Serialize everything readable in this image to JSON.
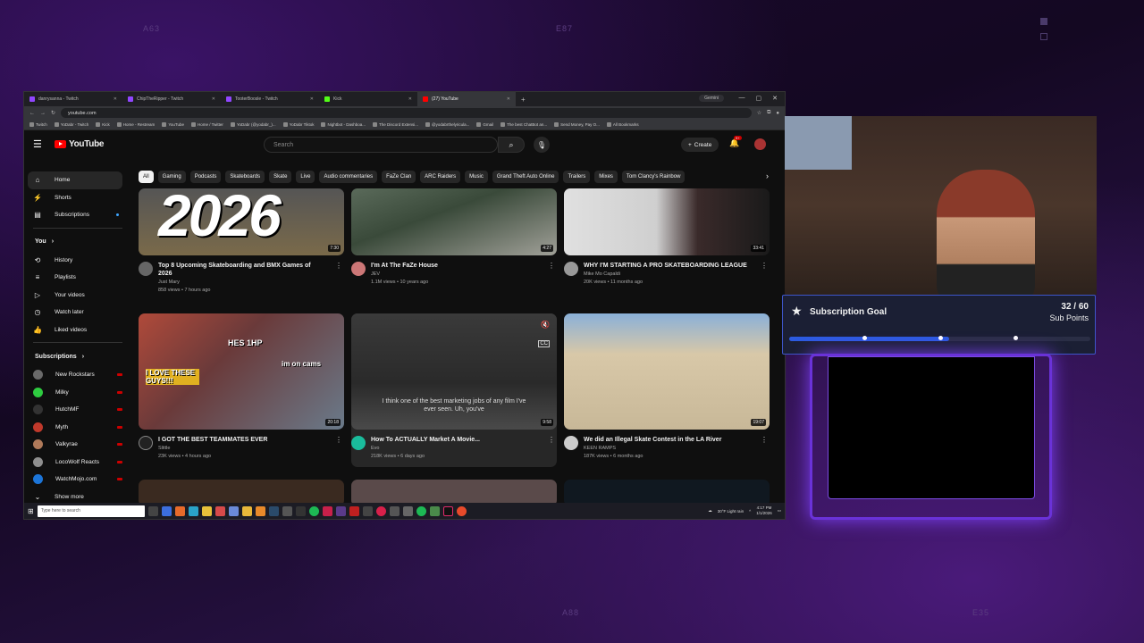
{
  "watermarks": {
    "top_left": "A63",
    "top_mid": "E87",
    "bottom_mid": "A88",
    "bottom_right": "E35"
  },
  "browser": {
    "tabs": [
      {
        "label": "danrysanna - Twitch"
      },
      {
        "label": "ChipTheRipper - Twitch"
      },
      {
        "label": "TooterBoosle - Twitch"
      },
      {
        "label": "Kick"
      },
      {
        "label": "(27) YouTube"
      }
    ],
    "gemini": "Gemini",
    "url": "youtube.com",
    "bookmarks": [
      "Twitch",
      "YoDabr - Twitch",
      "Kick",
      "Home - Restream",
      "YouTube",
      "Home / Twitter",
      "YoDabr (@yodabr_)...",
      "YoDabr Tiktok",
      "Nightbot - Dashboa...",
      "The Discord Extensi...",
      "@yodabrthelyricula...",
      "Gmail",
      "The best ChatBot an...",
      "Send Money, Pay O...",
      "All Bookmarks"
    ]
  },
  "youtube": {
    "logo": "YouTube",
    "search_placeholder": "Search",
    "create": "Create",
    "notif_count": "9+",
    "sidebar": [
      {
        "label": "Home",
        "icon": "home-icon"
      },
      {
        "label": "Shorts",
        "icon": "shorts-icon"
      },
      {
        "label": "Subscriptions",
        "icon": "subscriptions-icon"
      }
    ],
    "you": "You",
    "you_items": [
      {
        "label": "History"
      },
      {
        "label": "Playlists"
      },
      {
        "label": "Your videos"
      },
      {
        "label": "Watch later"
      },
      {
        "label": "Liked videos"
      }
    ],
    "subs_header": "Subscriptions",
    "subs": [
      {
        "label": "New Rockstars",
        "color": "#6a6a6a"
      },
      {
        "label": "Milky",
        "color": "#2ecc40"
      },
      {
        "label": "HutchMF",
        "color": "#333"
      },
      {
        "label": "Myth",
        "color": "#c0392b"
      },
      {
        "label": "Valkyrae",
        "color": "#b07a5a"
      },
      {
        "label": "LocoWolf Reacts",
        "color": "#8e8e8e"
      },
      {
        "label": "WatchMojo.com",
        "color": "#1c75d8"
      }
    ],
    "show_more": "Show more",
    "chips": [
      "All",
      "Gaming",
      "Podcasts",
      "Skateboards",
      "Skate",
      "Live",
      "Audio commentaries",
      "FaZe Clan",
      "ARC Raiders",
      "Music",
      "Grand Theft Auto Online",
      "Trailers",
      "Mixes",
      "Tom Clancy's Rainbow"
    ],
    "videos": [
      {
        "title": "Top 8 Upcoming Skateboarding and BMX Games of 2026",
        "channel": "Just Mary",
        "views": "858 views • 7 hours ago",
        "duration": "7:30",
        "thumb_text": "2026",
        "colors": [
          "#3b3b3b",
          "#7a6a4a"
        ],
        "avatar": "#666"
      },
      {
        "title": "I'm At The FaZe House",
        "channel": "JEV",
        "views": "1.1M views • 10 years ago",
        "duration": "4:27",
        "colors": [
          "#4a5a4a",
          "#8a8a80"
        ],
        "avatar": "#c77"
      },
      {
        "title": "WHY I'M STARTING A PRO SKATEBOARDING LEAGUE",
        "channel": "Mike Mo Capaldi",
        "views": "20K views • 11 months ago",
        "duration": "33:41",
        "colors": [
          "#d8d8d8",
          "#5a5050"
        ],
        "avatar": "#999"
      },
      {
        "title": "I GOT THE BEST TEAMMATES EVER",
        "channel": "Slittle",
        "views": "23K views • 4 hours ago",
        "duration": "20:18",
        "thumb_text": "HES 1HP",
        "thumb_text2": "im on cams",
        "thumb_text3": "I LOVE THESE GUYS!!!",
        "colors": [
          "#8a4a3a",
          "#6a7a8a"
        ],
        "avatar": "#222"
      },
      {
        "title": "How To ACTUALLY Market A Movie...",
        "channel": "Evo",
        "views": "218K views • 6 days ago",
        "duration": "9:58",
        "caption": "I think one of the best marketing jobs of any film I've ever seen. Uh, you've",
        "colors": [
          "#2a2a2a",
          "#5a5a5a"
        ],
        "avatar": "#1abc9c"
      },
      {
        "title": "We did an Illegal Skate Contest in the LA River",
        "channel": "KEEN RAMPS",
        "views": "187K views • 6 months ago",
        "duration": "19:07",
        "colors": [
          "#d8c8a8",
          "#8ab0d8"
        ],
        "avatar": "#ccc"
      }
    ]
  },
  "taskbar": {
    "search": "Type here to search",
    "weather": "30°F Light rain",
    "time": "4:17 PM",
    "date": "1/1/2026"
  },
  "goal": {
    "title": "Subscription Goal",
    "count": "32 / 60",
    "unit": "Sub Points",
    "progress": 0.53,
    "markers": [
      0.25,
      0.5,
      0.75
    ]
  },
  "colors": {
    "yt_bg": "#0f0f0f",
    "goal_accent": "#2c5be0",
    "frame_purple": "#6a32d8"
  }
}
